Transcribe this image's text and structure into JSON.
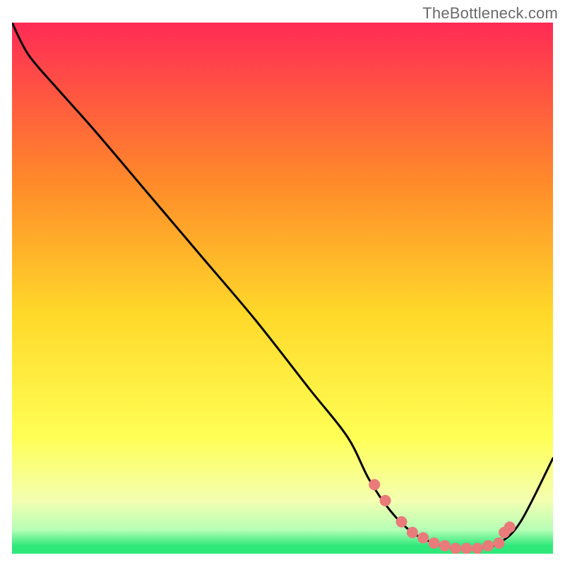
{
  "attribution": "TheBottleneck.com",
  "colors": {
    "top": "#ff2b55",
    "upper_mid": "#ff8a2a",
    "mid": "#ffd92a",
    "lower_mid": "#ffff55",
    "pale": "#f4ffb0",
    "green_light": "#b6ffb6",
    "green": "#2fe87a",
    "curve": "#000000",
    "marker_fill": "#e97b7b",
    "marker_stroke": "#c95555"
  },
  "chart_data": {
    "type": "line",
    "title": "",
    "xlabel": "",
    "ylabel": "",
    "xlim": [
      0,
      100
    ],
    "ylim": [
      0,
      100
    ],
    "grid": false,
    "legend": false,
    "series": [
      {
        "name": "bottleneck-curve",
        "x": [
          0,
          3,
          8,
          15,
          25,
          35,
          45,
          55,
          62,
          66,
          70,
          74,
          78,
          82,
          86,
          90,
          94,
          100
        ],
        "y": [
          100,
          94,
          88,
          80,
          68,
          56,
          44,
          31,
          22,
          14,
          8,
          4,
          2,
          1,
          1,
          2,
          6,
          18
        ]
      }
    ],
    "markers": {
      "name": "highlighted-points",
      "x": [
        67,
        69,
        72,
        74,
        76,
        78,
        80,
        82,
        84,
        86,
        88,
        90,
        91,
        92
      ],
      "y": [
        13,
        10,
        6,
        4,
        3,
        2,
        1.5,
        1,
        1,
        1,
        1.5,
        2,
        4,
        5
      ]
    },
    "background_gradient_stops": [
      {
        "offset": 0.0,
        "color_key": "top"
      },
      {
        "offset": 0.3,
        "color_key": "upper_mid"
      },
      {
        "offset": 0.55,
        "color_key": "mid"
      },
      {
        "offset": 0.78,
        "color_key": "lower_mid"
      },
      {
        "offset": 0.9,
        "color_key": "pale"
      },
      {
        "offset": 0.955,
        "color_key": "green_light"
      },
      {
        "offset": 0.985,
        "color_key": "green"
      },
      {
        "offset": 1.0,
        "color_key": "green"
      }
    ]
  }
}
